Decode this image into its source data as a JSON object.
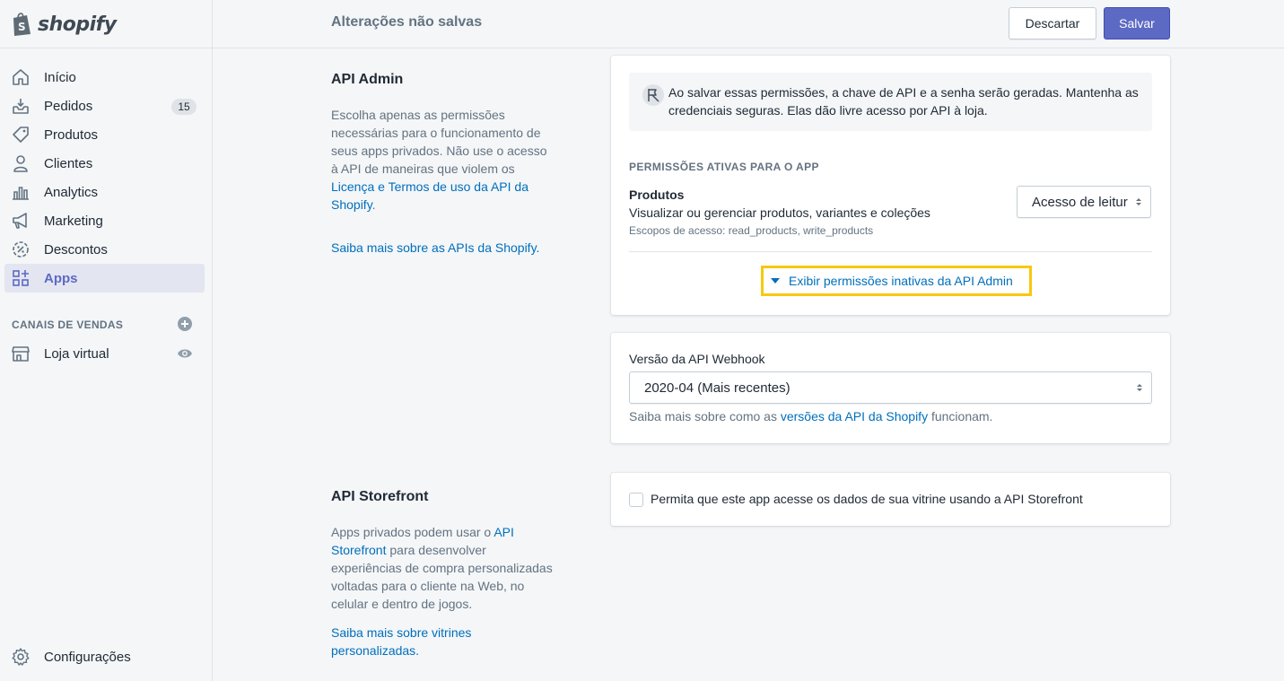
{
  "brand": {
    "logo_text": "shopify",
    "accent": "#5c6ac4",
    "link": "#006fbb",
    "highlight": "#f7c810"
  },
  "sidebar": {
    "items": [
      {
        "label": "Início",
        "icon": "home-icon"
      },
      {
        "label": "Pedidos",
        "icon": "orders-icon",
        "badge": "15"
      },
      {
        "label": "Produtos",
        "icon": "tag-icon"
      },
      {
        "label": "Clientes",
        "icon": "person-icon"
      },
      {
        "label": "Analytics",
        "icon": "analytics-icon"
      },
      {
        "label": "Marketing",
        "icon": "megaphone-icon"
      },
      {
        "label": "Descontos",
        "icon": "discount-icon"
      },
      {
        "label": "Apps",
        "icon": "apps-icon",
        "active": true
      }
    ],
    "channels_heading": "CANAIS DE VENDAS",
    "channel_item": {
      "label": "Loja virtual",
      "icon": "store-icon"
    },
    "settings": {
      "label": "Configurações",
      "icon": "gear-icon"
    }
  },
  "topbar": {
    "title": "Alterações não salvas",
    "discard_label": "Descartar",
    "save_label": "Salvar"
  },
  "admin_section": {
    "title": "API Admin",
    "desc_text": "Escolha apenas as permissões necessárias para o funcionamento de seus apps privados. Não use o acesso à API de maneiras que violem os ",
    "desc_link": "Licença e Termos de uso da API da Shopify",
    "desc_end": ".",
    "learn_link": "Saiba mais sobre as APIs da Shopify."
  },
  "admin_card": {
    "notice": "Ao salvar essas permissões, a chave de API e a senha serão geradas. Mantenha as credenciais seguras. Elas dão livre acesso por API à loja.",
    "permissions_heading": "PERMISSÕES ATIVAS PARA O APP",
    "permission": {
      "title": "Produtos",
      "subtitle": "Visualizar ou gerenciar produtos, variantes e coleções",
      "scopes": "Escopos de acesso: read_products, write_products",
      "access_value": "Acesso de leitur"
    },
    "show_inactive": "Exibir permissões inativas da API Admin"
  },
  "webhook_card": {
    "label": "Versão da API Webhook",
    "selected": "2020-04 (Mais recentes)",
    "help_prefix": "Saiba mais sobre como as ",
    "help_link": "versões da API da Shopify",
    "help_suffix": " funcionam."
  },
  "storefront_section": {
    "title": "API Storefront",
    "desc_prefix": "Apps privados podem usar o ",
    "desc_link": "API Storefront",
    "desc_suffix": " para desenvolver experiências de compra personalizadas voltadas para o cliente na Web, no celular e dentro de jogos.",
    "learn_link": "Saiba mais sobre vitrines personalizadas."
  },
  "storefront_card": {
    "checkbox_label": "Permita que este app acesse os dados de sua vitrine usando a API Storefront",
    "checked": false
  }
}
